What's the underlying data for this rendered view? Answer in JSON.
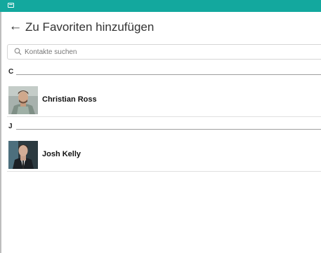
{
  "title": "Zu Favoriten hinzufügen",
  "search": {
    "placeholder": "Kontakte suchen"
  },
  "sections": [
    {
      "letter": "C",
      "contacts": [
        {
          "name": "Christian Ross",
          "avatar": "person-photo"
        }
      ]
    },
    {
      "letter": "J",
      "contacts": [
        {
          "name": "Josh Kelly",
          "avatar": "person-photo"
        }
      ]
    }
  ],
  "colors": {
    "status_bar": "#13a89e",
    "divider": "#e0e0e0"
  },
  "icons": {
    "status": "window-icon",
    "back": "arrow-left-icon",
    "search": "search-icon"
  }
}
